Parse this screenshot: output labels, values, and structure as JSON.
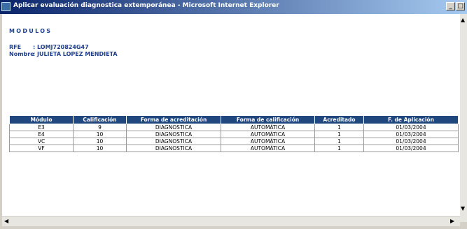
{
  "window": {
    "title": "Aplicar evaluación diagnostica extemporánea - Microsoft Internet Explorer"
  },
  "page": {
    "heading": "MODULOS",
    "rfe_label": "RFE",
    "rfe_value": ": LOMJ720824G47",
    "nombre_label": "Nombre",
    "nombre_value": ": JULIETA LOPEZ MENDIETA"
  },
  "table": {
    "headers": [
      "Módulo",
      "Calificación",
      "Forma de acreditación",
      "Forma de calificación",
      "Acreditado",
      "F. de Aplicación"
    ],
    "rows": [
      [
        "E3",
        "9",
        "DIAGNOSTICA",
        "AUTOMÁTICA",
        "1",
        "01/03/2004"
      ],
      [
        "E4",
        "10",
        "DIAGNOSTICA",
        "AUTOMÁTICA",
        "1",
        "01/03/2004"
      ],
      [
        "VC",
        "10",
        "DIAGNOSTICA",
        "AUTOMÁTICA",
        "1",
        "01/03/2004"
      ],
      [
        "VF",
        "10",
        "DIAGNOSTICA",
        "AUTOMÁTICA",
        "1",
        "01/03/2004"
      ]
    ]
  },
  "colors": {
    "accent": "#21477f",
    "text": "#1f3f8a"
  },
  "icons": {
    "window": "ie-page-icon",
    "minimize": "minimize-icon",
    "maximize": "maximize-icon",
    "close": "close-icon"
  }
}
